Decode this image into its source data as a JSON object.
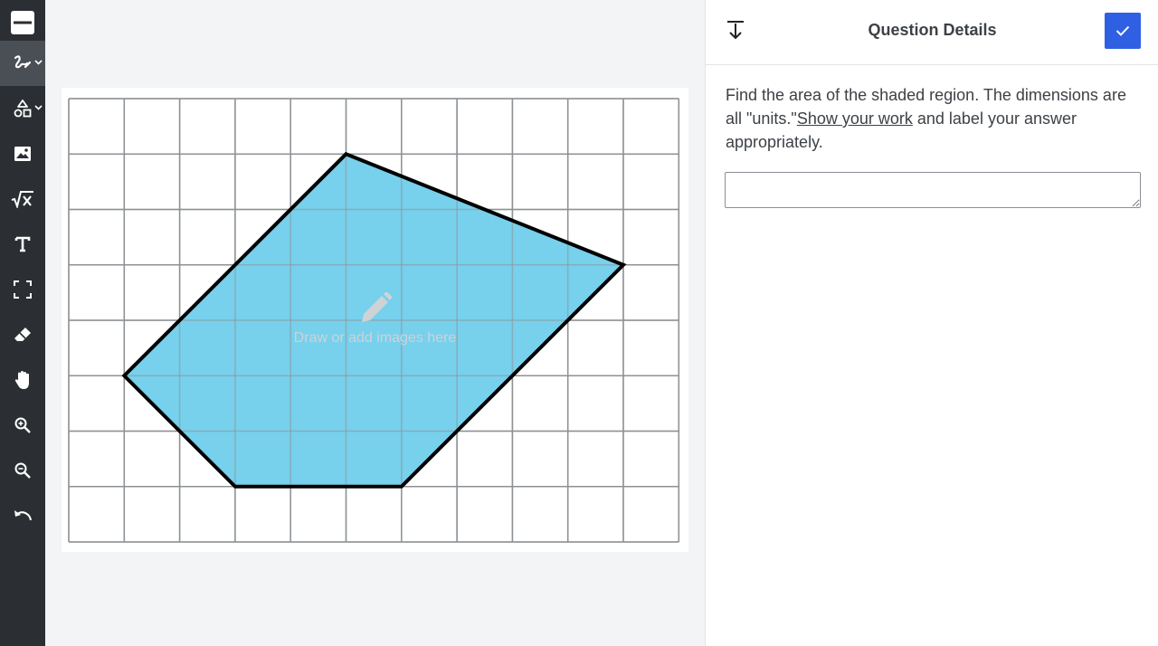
{
  "toolbar": {
    "tools": [
      {
        "name": "menu",
        "icon": "menu-bar-icon"
      },
      {
        "name": "pen",
        "icon": "pen-scribble-icon",
        "active": true
      },
      {
        "name": "shapes",
        "icon": "shapes-icon"
      },
      {
        "name": "image",
        "icon": "image-icon"
      },
      {
        "name": "math",
        "icon": "square-root-icon"
      },
      {
        "name": "text",
        "icon": "text-icon"
      },
      {
        "name": "select",
        "icon": "select-frame-icon"
      },
      {
        "name": "eraser",
        "icon": "eraser-icon"
      },
      {
        "name": "pan",
        "icon": "hand-icon"
      },
      {
        "name": "zoom-in",
        "icon": "zoom-in-icon"
      },
      {
        "name": "zoom-out",
        "icon": "zoom-out-icon"
      },
      {
        "name": "undo",
        "icon": "undo-icon"
      }
    ]
  },
  "canvas": {
    "placeholder": "Draw or add images here",
    "grid": {
      "columns": 11,
      "rows": 8
    },
    "shaded_polygon_vertices": [
      [
        5,
        1
      ],
      [
        10,
        3
      ],
      [
        6,
        7
      ],
      [
        3,
        7
      ],
      [
        1,
        5
      ]
    ],
    "fill_color": "#77d0ec",
    "stroke_color": "#000000"
  },
  "panel": {
    "title": "Question Details",
    "question_part1": "Find the area of the shaded region. The dimensions are all \"units.\"",
    "question_link": "Show your work",
    "question_part2": " and label your answer appropriately.",
    "answer_value": "",
    "accent_color": "#2f5fe3"
  }
}
